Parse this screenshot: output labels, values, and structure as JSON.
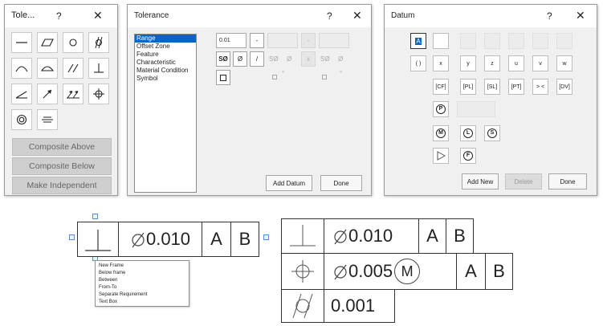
{
  "tolerance_palette": {
    "title": "Tole...",
    "help": "?",
    "close": "✕",
    "buttons": {
      "composite_above": "Composite Above",
      "composite_below": "Composite Below",
      "make_independent": "Make Independent"
    }
  },
  "tolerance_dialog": {
    "title": "Tolerance",
    "help": "?",
    "close": "✕",
    "list": [
      "Range",
      "Offset Zone",
      "Feature",
      "Characteristic",
      "Material Condition",
      "Symbol"
    ],
    "value": "0.01",
    "minus": "-",
    "plus_disabled": "-",
    "sphere_dia": "SØ",
    "dia": "Ø",
    "slash": "/",
    "g_sphere_dia": "SØ",
    "g_dia": "Ø",
    "x": "x",
    "g_sphere_dia_2": "SØ",
    "g_dia_2": "Ø",
    "deg_1": "°",
    "deg_2": "°",
    "add_datum": "Add Datum",
    "done": "Done"
  },
  "datum_dialog": {
    "title": "Datum",
    "help": "?",
    "close": "✕",
    "selected_cell": "A",
    "row_letters": [
      "( )",
      "x",
      "y",
      "z",
      "u",
      "v",
      "w"
    ],
    "row_brackets": [
      "[CF]",
      "[PL]",
      "[SL]",
      "[PT]",
      "> <",
      "[DV]"
    ],
    "p_symbol": "P",
    "m_symbol": "M",
    "l_symbol": "L",
    "s_symbol": "S",
    "f_symbol": "F",
    "add_new": "Add New",
    "delete": "Delete",
    "done": "Done"
  },
  "frame_left": {
    "tolerance": "0.010",
    "datum_a": "A",
    "datum_b": "B"
  },
  "context_menu": {
    "items": [
      "New Frame",
      "Below frame",
      "Between",
      "From-To",
      "Separate Requirement",
      "Text Box"
    ]
  },
  "frame_right": {
    "row1": {
      "tolerance": "0.010",
      "datum_a": "A",
      "datum_b": "B"
    },
    "row2": {
      "tolerance": "0.005",
      "modifier": "M",
      "datum_a": "A",
      "datum_b": "B"
    },
    "row3": {
      "tolerance": "0.001"
    }
  }
}
